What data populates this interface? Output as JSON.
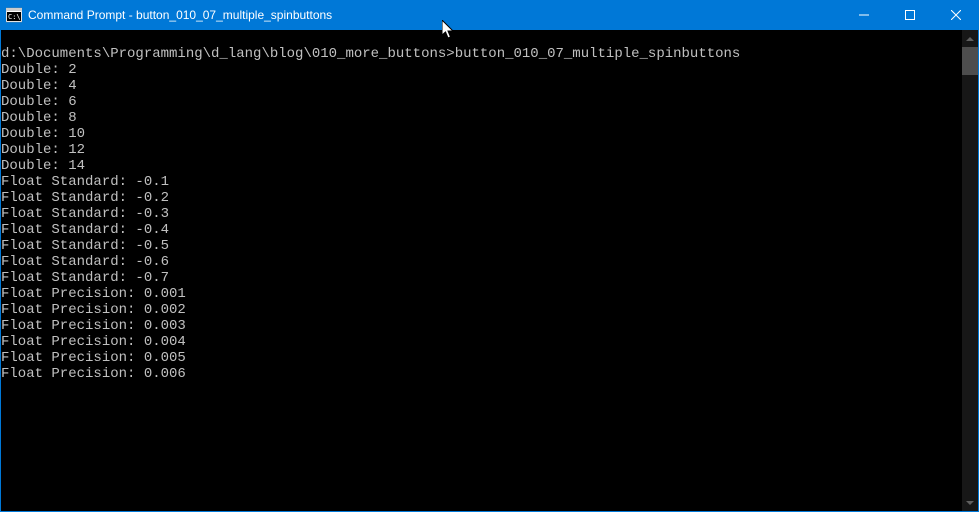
{
  "titlebar": {
    "title": "Command Prompt - button_010_07_multiple_spinbuttons"
  },
  "terminal": {
    "prompt_path": "d:\\Documents\\Programming\\d_lang\\blog\\010_more_buttons>",
    "command": "button_010_07_multiple_spinbuttons",
    "output_lines": [
      "Double: 2",
      "Double: 4",
      "Double: 6",
      "Double: 8",
      "Double: 10",
      "Double: 12",
      "Double: 14",
      "Float Standard: -0.1",
      "Float Standard: -0.2",
      "Float Standard: -0.3",
      "Float Standard: -0.4",
      "Float Standard: -0.5",
      "Float Standard: -0.6",
      "Float Standard: -0.7",
      "Float Precision: 0.001",
      "Float Precision: 0.002",
      "Float Precision: 0.003",
      "Float Precision: 0.004",
      "Float Precision: 0.005",
      "Float Precision: 0.006"
    ]
  }
}
